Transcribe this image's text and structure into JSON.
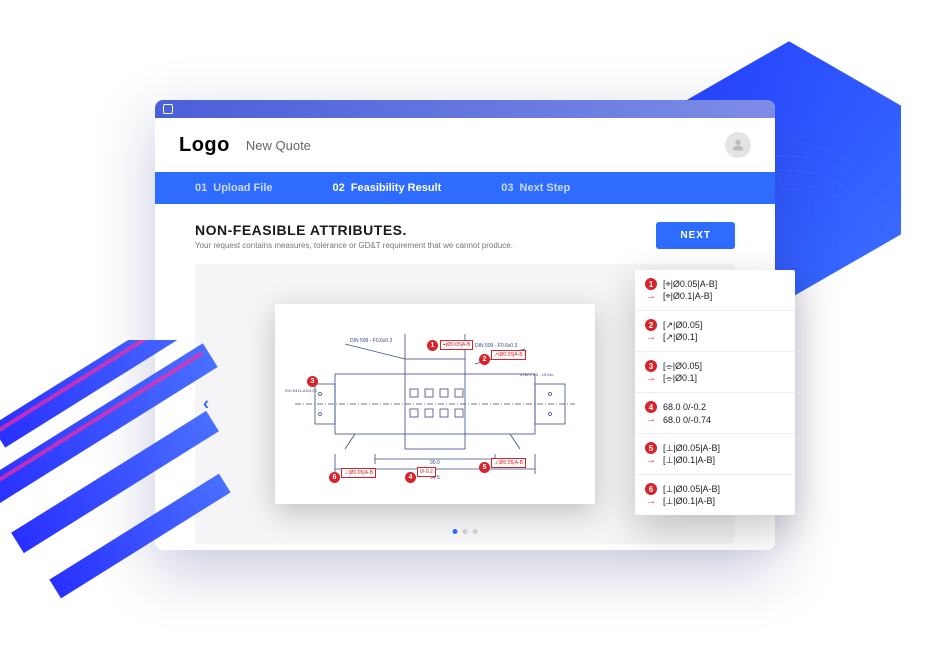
{
  "header": {
    "logo": "Logo",
    "page_title": "New Quote"
  },
  "steps": [
    {
      "num": "01",
      "label": "Upload File",
      "active": false
    },
    {
      "num": "02",
      "label": "Feasibility Result",
      "active": true
    },
    {
      "num": "03",
      "label": "Next Step",
      "active": false
    }
  ],
  "content": {
    "title": "NON-FEASIBLE ATTRIBUTES.",
    "subtitle": "Your request contains measures, tolerance or GD&T requirement that we cannot produce.",
    "next_button": "NEXT"
  },
  "attributes": [
    {
      "n": "1",
      "from": "[⌖|Ø0.05|A-B]",
      "to": "[⌖|Ø0.1|A-B]"
    },
    {
      "n": "2",
      "from": "[↗|Ø0.05]",
      "to": "[↗|Ø0.1]"
    },
    {
      "n": "3",
      "from": "[⌯|Ø0.05]",
      "to": "[⌯|Ø0.1]"
    },
    {
      "n": "4",
      "from": "68.0 0/-0.2",
      "to": "68.0 0/-0.74"
    },
    {
      "n": "5",
      "from": "[⊥|Ø0.05|A-B]",
      "to": "[⊥|Ø0.1|A-B]"
    },
    {
      "n": "6",
      "from": "[⊥|Ø0.05|A-B]",
      "to": "[⊥|Ø0.1|A-B]"
    }
  ],
  "drawing": {
    "annotations": [
      "DIN 509 - F0.6x0.3",
      "DIN 509 - F0.6x0.3",
      "ISO 6411-A2/4.25",
      "5.N6 x 0.5 - 15 Mn."
    ],
    "callouts": [
      "1",
      "2",
      "3",
      "4",
      "5",
      "6"
    ]
  }
}
